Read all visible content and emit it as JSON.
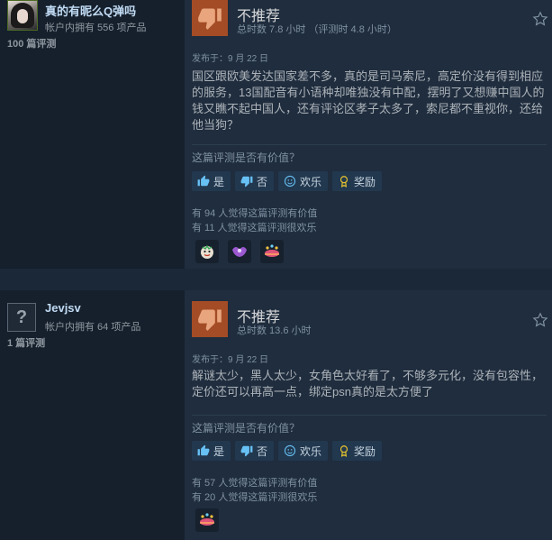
{
  "reviews": [
    {
      "username": "真的有昵么Q弹吗",
      "owned": "帐户内拥有 556 项产品",
      "count": "100 篇评测",
      "verdict": "不推荐",
      "playtime": "总时数 7.8 小时 （评测时 4.8 小时）",
      "posted": "发布于：9 月 22 日",
      "text": "国区跟欧美发达国家差不多，真的是司马索尼，高定价没有得到相应的服务，13国配音有小语种却唯独没有中配，摆明了又想赚中国人的钱又瞧不起中国人，还有评论区孝子太多了，索尼都不重视你，还给他当狗？",
      "question": "这篇评测是否有价值？",
      "helpful": "有 94 人觉得这篇评测有价值",
      "funny": "有 11 人觉得这篇评测很欢乐",
      "awards": [
        "face-award-icon",
        "purple-award-icon",
        "party-award-icon"
      ]
    },
    {
      "username": "Jevjsv",
      "avatar_placeholder": "?",
      "owned": "帐户内拥有 64 项产品",
      "count": "1 篇评测",
      "verdict": "不推荐",
      "playtime": "总时数 13.6 小时",
      "posted": "发布于：9 月 22 日",
      "text": "解谜太少，黑人太少，女角色太好看了，不够多元化，没有包容性，定价还可以再高一点，绑定psn真的是太方便了",
      "question": "这篇评测是否有价值？",
      "helpful": "有 57 人觉得这篇评测有价值",
      "funny": "有 20 人觉得这篇评测很欢乐",
      "awards": [
        "party-award-icon"
      ]
    }
  ],
  "buttons": {
    "yes": "是",
    "no": "否",
    "funny": "欢乐",
    "award": "奖励"
  },
  "colors": {
    "background": "#1b2838",
    "panel": "#1f2d3e",
    "thumb_down": "#a34c25",
    "link": "#67c1f5"
  }
}
